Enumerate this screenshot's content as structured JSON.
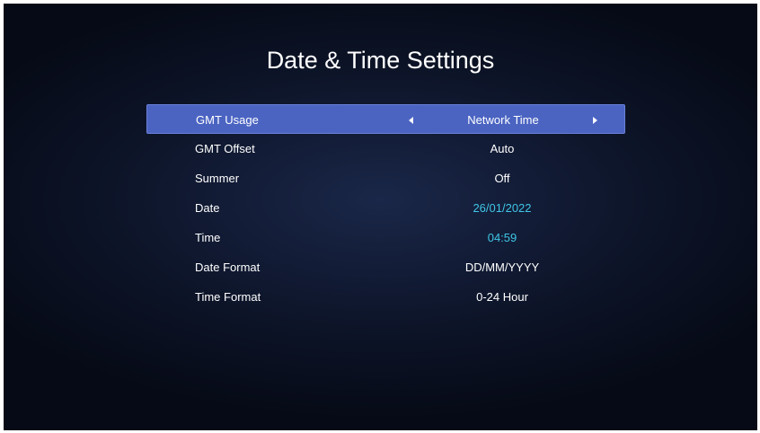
{
  "page": {
    "title": "Date & Time Settings"
  },
  "colors": {
    "highlight": "#4b64c2",
    "accent_value": "#3fc6e6",
    "text": "#ffffff",
    "background": "#0c1326"
  },
  "settings": {
    "items": [
      {
        "label": "GMT Usage",
        "value": "Network Time",
        "selected": true
      },
      {
        "label": "GMT Offset",
        "value": "Auto"
      },
      {
        "label": "Summer",
        "value": "Off"
      },
      {
        "label": "Date",
        "value": "26/01/2022"
      },
      {
        "label": "Time",
        "value": "04:59"
      },
      {
        "label": "Date Format",
        "value": "DD/MM/YYYY"
      },
      {
        "label": "Time Format",
        "value": "0-24 Hour"
      }
    ]
  }
}
